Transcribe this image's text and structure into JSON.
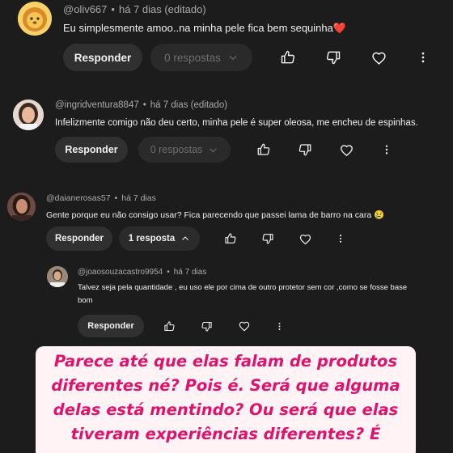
{
  "comments": [
    {
      "username": "@oliv667",
      "time": "há 7 dias (editado)",
      "text": "Eu simplesmente amoo..na minha pele fica bem sequinha❤️",
      "reply_label": "Responder",
      "replies_label": "0 respostas"
    },
    {
      "username": "@ingridventura8847",
      "time": "há 7 dias (editado)",
      "text": "Infelizmente comigo não deu certo, minha pele é super oleosa, me encheu de espinhas.",
      "reply_label": "Responder",
      "replies_label": "0 respostas"
    },
    {
      "username": "@daianerosas57",
      "time": "há 7 dias",
      "text": "Gente porque eu não consigo usar? Fica parecendo que passei lama de barro na cara 😢",
      "reply_label": "Responder",
      "replies_label": "1 resposta"
    },
    {
      "username": "@joaosouzacastro9954",
      "time": "há 7 dias",
      "text_line1": "Talvez seja pela quantidade , eu uso ele por cima de outro protetor sem cor ,como se fosse base",
      "text_line2": "bom",
      "reply_label": "Responder"
    }
  ],
  "separator": "•",
  "overlay": {
    "line1": "Parece até que elas falam de produtos",
    "line2": "diferentes né? Pois é. Será que alguma",
    "line3": "delas está mentindo? Ou será que elas",
    "line4": "tiveram experiências diferentes? É"
  },
  "colors": {
    "background": "#1c1c1c",
    "overlay_bg": "#fff3f6",
    "overlay_text": "#e0136a"
  },
  "icons": [
    "like-icon",
    "dislike-icon",
    "heart-icon",
    "more-icon",
    "chevron-down-icon",
    "chevron-up-icon"
  ]
}
